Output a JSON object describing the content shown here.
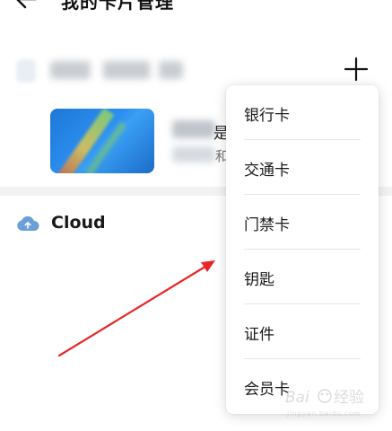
{
  "header": {
    "title": "我的卡片管理"
  },
  "card": {
    "text_line_1": "是",
    "text_line_2": "和"
  },
  "cloud": {
    "label": "Cloud"
  },
  "menu": {
    "items": [
      {
        "label": "银行卡"
      },
      {
        "label": "交通卡"
      },
      {
        "label": "门禁卡"
      },
      {
        "label": "钥匙"
      },
      {
        "label": "证件"
      },
      {
        "label": "会员卡"
      }
    ]
  },
  "colors": {
    "annotation_arrow": "#e8262a",
    "cloud_icon": "#6a9fd8"
  }
}
